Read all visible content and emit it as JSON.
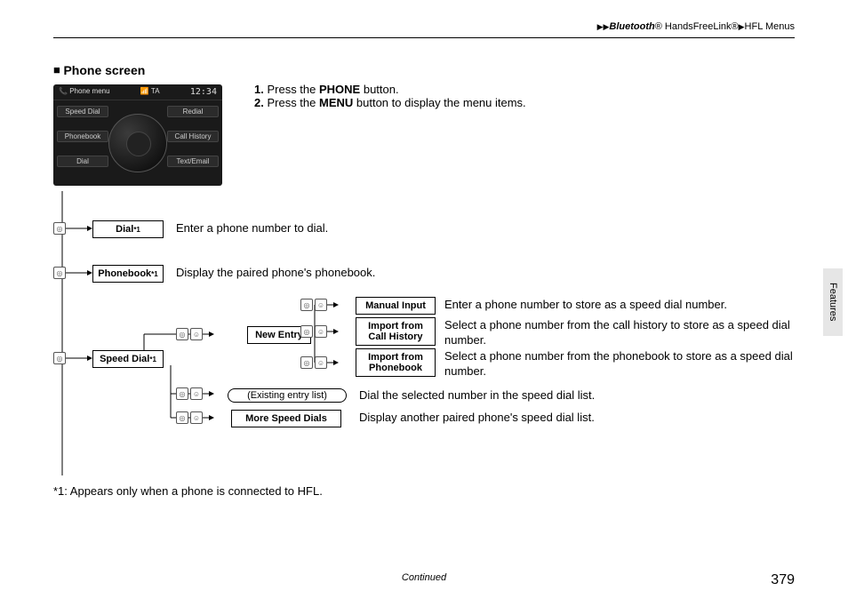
{
  "header": {
    "b1": "Bluetooth",
    "b2": "® HandsFreeLink®",
    "b3": "HFL Menus"
  },
  "section_title": "Phone screen",
  "instructions": {
    "l1a": "1.",
    "l1b": "Press the ",
    "l1c": "PHONE",
    "l1d": " button.",
    "l2a": "2.",
    "l2b": "Press the ",
    "l2c": "MENU",
    "l2d": " button to display the menu items."
  },
  "screenshot": {
    "title": "Phone menu",
    "badge": "TA",
    "time": "12:34",
    "btn_tl": "Speed Dial",
    "btn_tr": "Redial",
    "btn_ml": "Phonebook",
    "btn_mr": "Call History",
    "btn_bl": "Dial",
    "btn_br": "Text/Email"
  },
  "nodes": {
    "dial": "Dial",
    "dial_sup": "*1",
    "dial_desc": "Enter a phone number to dial.",
    "phonebook": "Phonebook",
    "phonebook_sup": "*1",
    "phonebook_desc": "Display the paired phone's phonebook.",
    "speeddial": "Speed Dial",
    "speeddial_sup": "*1",
    "newentry": "New Entry",
    "manual": "Manual Input",
    "manual_desc": "Enter a phone number to store as a speed dial number.",
    "import_hist": "Import from Call History",
    "import_hist_desc": "Select a phone number from the call history to store as a speed dial number.",
    "import_pb": "Import from Phonebook",
    "import_pb_desc": "Select a phone number from the phonebook to store as a speed dial number.",
    "existing": "(Existing entry list)",
    "existing_desc": "Dial the selected number in the speed dial list.",
    "more": "More Speed Dials",
    "more_desc": "Display another paired phone's speed dial list."
  },
  "footnote": "*1: Appears only when a phone is connected to HFL.",
  "continued": "Continued",
  "page": "379",
  "side_tab": "Features"
}
